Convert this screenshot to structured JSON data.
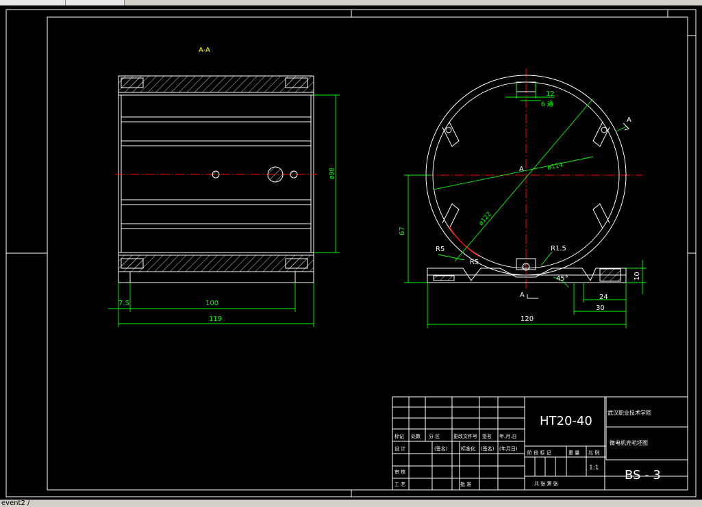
{
  "window": {
    "status_text": "event2 /"
  },
  "drawing": {
    "section_label": "A-A",
    "section_mark_left": "A",
    "section_mark_bottom": "A",
    "section_arrow": "A",
    "center_label": "A",
    "dims": {
      "d98": "ø98",
      "d114": "ø114",
      "d122": "ø122",
      "w7_5": "7.5",
      "w100": "100",
      "w119": "119",
      "w12": "12",
      "w6": "6 通",
      "h67": "67",
      "r5a": "R5",
      "r5b": "R5",
      "r1_5": "R1.5",
      "a45": "45°",
      "w24": "24",
      "w30": "30",
      "h10": "10",
      "w120": "120"
    }
  },
  "title_block": {
    "material": "HT20-40",
    "school": "武汉职业技术学院",
    "drawing_name": "微电机壳毛坯图",
    "drawing_no": "BS - 3",
    "scale": "1:1",
    "cells": {
      "r1c1": "标记",
      "r1c2": "处数",
      "r1c3": "分 区",
      "r1c4": "更改文件号",
      "r1c5": "签名",
      "r1c6": "年.月.日",
      "r2c1": "设 计",
      "r2c2": "(签名)",
      "r2c3": "标准化",
      "r2c4": "(签名)",
      "r2c5": "(年月日)",
      "stage": "阶 段 标 记",
      "weight": "重 量",
      "scale_h": "比 例",
      "review": "审 核",
      "craft": "工 艺",
      "approve": "批 准",
      "sheets": "共    张    第    张"
    }
  }
}
